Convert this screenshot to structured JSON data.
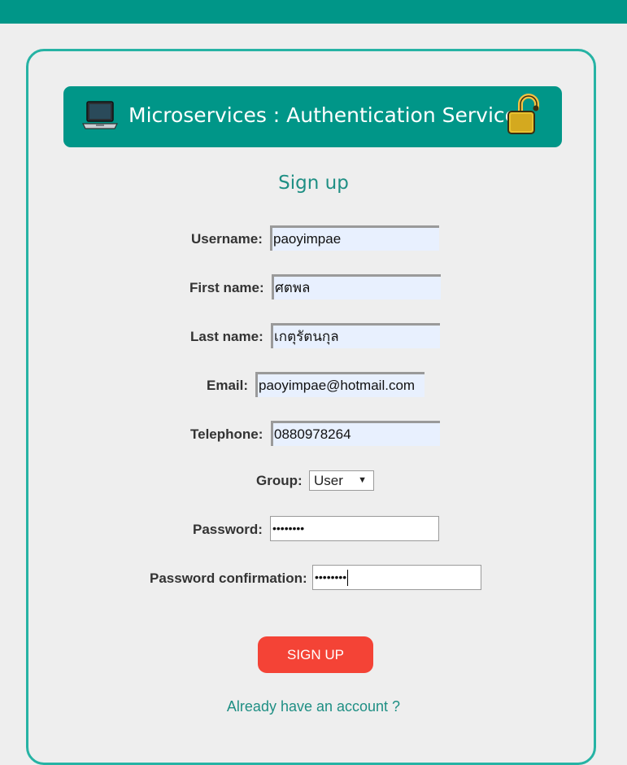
{
  "header": {
    "title": "Microservices : Authentication Service",
    "left_icon": "laptop-icon",
    "right_icon": "lock-icon"
  },
  "form": {
    "heading": "Sign up",
    "username": {
      "label": "Username:",
      "value": "paoyimpae"
    },
    "first_name": {
      "label": "First name:",
      "value": "ศตพล"
    },
    "last_name": {
      "label": "Last name:",
      "value": "เกตุรัตนกุล"
    },
    "email": {
      "label": "Email:",
      "value": "paoyimpae@hotmail.com"
    },
    "telephone": {
      "label": "Telephone:",
      "value": "0880978264"
    },
    "group": {
      "label": "Group:",
      "selected": "User"
    },
    "password": {
      "label": "Password:",
      "value": "••••••••"
    },
    "password_confirmation": {
      "label": "Password confirmation:",
      "value": "••••••••"
    },
    "submit_label": "SIGN UP",
    "login_link": "Already have an account ?"
  },
  "colors": {
    "brand": "#009688",
    "accent_text": "#1f8f84",
    "card_border": "#26b3a4",
    "button": "#f44336",
    "autofill": "#e8f0fe"
  }
}
